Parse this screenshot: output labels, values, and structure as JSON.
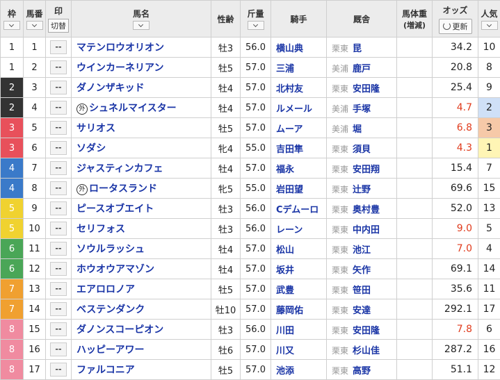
{
  "header": {
    "waku": "枠",
    "umaban": "馬番",
    "mark": "印",
    "mark_toggle": "切替",
    "name": "馬名",
    "sexage": "性齢",
    "kinryo": "斤量",
    "jockey": "騎手",
    "trainer": "厩舎",
    "weight": "馬体重",
    "weight_sub": "(増減)",
    "odds": "オッズ",
    "refresh": "更新",
    "ninki": "人気"
  },
  "waku_colors": {
    "1": {
      "bg": "#ffffff",
      "fg": "#222222"
    },
    "2": {
      "bg": "#333333",
      "fg": "#ffffff"
    },
    "3": {
      "bg": "#e8505b",
      "fg": "#ffffff"
    },
    "4": {
      "bg": "#3a7ac9",
      "fg": "#ffffff"
    },
    "5": {
      "bg": "#f0d230",
      "fg": "#ffffff"
    },
    "6": {
      "bg": "#4aa657",
      "fg": "#ffffff"
    },
    "7": {
      "bg": "#f0a030",
      "fg": "#ffffff"
    },
    "8": {
      "bg": "#f08ba0",
      "fg": "#ffffff"
    }
  },
  "mark_default": "--",
  "gaikoku_symbol": "外",
  "rows": [
    {
      "waku": "1",
      "umaban": "1",
      "name": "マテンロウオリオン",
      "gai": false,
      "sexage": "牡3",
      "kinryo": "56.0",
      "jockey": "横山典",
      "region": "栗東",
      "trainer": "昆",
      "weight": "",
      "odds": "34.2",
      "hot": false,
      "ninki": "10"
    },
    {
      "waku": "1",
      "umaban": "2",
      "name": "ウインカーネリアン",
      "gai": false,
      "sexage": "牡5",
      "kinryo": "57.0",
      "jockey": "三浦",
      "region": "美浦",
      "trainer": "鹿戸",
      "weight": "",
      "odds": "20.8",
      "hot": false,
      "ninki": "8"
    },
    {
      "waku": "2",
      "umaban": "3",
      "name": "ダノンザキッド",
      "gai": false,
      "sexage": "牡4",
      "kinryo": "57.0",
      "jockey": "北村友",
      "region": "栗東",
      "trainer": "安田隆",
      "weight": "",
      "odds": "25.4",
      "hot": false,
      "ninki": "9"
    },
    {
      "waku": "2",
      "umaban": "4",
      "name": "シュネルマイスター",
      "gai": true,
      "sexage": "牡4",
      "kinryo": "57.0",
      "jockey": "ルメール",
      "region": "美浦",
      "trainer": "手塚",
      "weight": "",
      "odds": "4.7",
      "hot": true,
      "ninki": "2"
    },
    {
      "waku": "3",
      "umaban": "5",
      "name": "サリオス",
      "gai": false,
      "sexage": "牡5",
      "kinryo": "57.0",
      "jockey": "ムーア",
      "region": "美浦",
      "trainer": "堀",
      "weight": "",
      "odds": "6.8",
      "hot": true,
      "ninki": "3"
    },
    {
      "waku": "3",
      "umaban": "6",
      "name": "ソダシ",
      "gai": false,
      "sexage": "牝4",
      "kinryo": "55.0",
      "jockey": "吉田隼",
      "region": "栗東",
      "trainer": "須貝",
      "weight": "",
      "odds": "4.3",
      "hot": true,
      "ninki": "1"
    },
    {
      "waku": "4",
      "umaban": "7",
      "name": "ジャスティンカフェ",
      "gai": false,
      "sexage": "牡4",
      "kinryo": "57.0",
      "jockey": "福永",
      "region": "栗東",
      "trainer": "安田翔",
      "weight": "",
      "odds": "15.4",
      "hot": false,
      "ninki": "7"
    },
    {
      "waku": "4",
      "umaban": "8",
      "name": "ロータスランド",
      "gai": true,
      "sexage": "牝5",
      "kinryo": "55.0",
      "jockey": "岩田望",
      "region": "栗東",
      "trainer": "辻野",
      "weight": "",
      "odds": "69.6",
      "hot": false,
      "ninki": "15"
    },
    {
      "waku": "5",
      "umaban": "9",
      "name": "ピースオブエイト",
      "gai": false,
      "sexage": "牡3",
      "kinryo": "56.0",
      "jockey": "Cデムーロ",
      "region": "栗東",
      "trainer": "奥村豊",
      "weight": "",
      "odds": "52.0",
      "hot": false,
      "ninki": "13"
    },
    {
      "waku": "5",
      "umaban": "10",
      "name": "セリフォス",
      "gai": false,
      "sexage": "牡3",
      "kinryo": "56.0",
      "jockey": "レーン",
      "region": "栗東",
      "trainer": "中内田",
      "weight": "",
      "odds": "9.0",
      "hot": true,
      "ninki": "5"
    },
    {
      "waku": "6",
      "umaban": "11",
      "name": "ソウルラッシュ",
      "gai": false,
      "sexage": "牡4",
      "kinryo": "57.0",
      "jockey": "松山",
      "region": "栗東",
      "trainer": "池江",
      "weight": "",
      "odds": "7.0",
      "hot": true,
      "ninki": "4"
    },
    {
      "waku": "6",
      "umaban": "12",
      "name": "ホウオウアマゾン",
      "gai": false,
      "sexage": "牡4",
      "kinryo": "57.0",
      "jockey": "坂井",
      "region": "栗東",
      "trainer": "矢作",
      "weight": "",
      "odds": "69.1",
      "hot": false,
      "ninki": "14"
    },
    {
      "waku": "7",
      "umaban": "13",
      "name": "エアロロノア",
      "gai": false,
      "sexage": "牡5",
      "kinryo": "57.0",
      "jockey": "武豊",
      "region": "栗東",
      "trainer": "笹田",
      "weight": "",
      "odds": "35.6",
      "hot": false,
      "ninki": "11"
    },
    {
      "waku": "7",
      "umaban": "14",
      "name": "ベステンダンク",
      "gai": false,
      "sexage": "牡10",
      "kinryo": "57.0",
      "jockey": "藤岡佑",
      "region": "栗東",
      "trainer": "安達",
      "weight": "",
      "odds": "292.1",
      "hot": false,
      "ninki": "17"
    },
    {
      "waku": "8",
      "umaban": "15",
      "name": "ダノンスコーピオン",
      "gai": false,
      "sexage": "牡3",
      "kinryo": "56.0",
      "jockey": "川田",
      "region": "栗東",
      "trainer": "安田隆",
      "weight": "",
      "odds": "7.8",
      "hot": true,
      "ninki": "6"
    },
    {
      "waku": "8",
      "umaban": "16",
      "name": "ハッピーアワー",
      "gai": false,
      "sexage": "牡6",
      "kinryo": "57.0",
      "jockey": "川又",
      "region": "栗東",
      "trainer": "杉山佳",
      "weight": "",
      "odds": "287.2",
      "hot": false,
      "ninki": "16"
    },
    {
      "waku": "8",
      "umaban": "17",
      "name": "ファルコニア",
      "gai": false,
      "sexage": "牡5",
      "kinryo": "57.0",
      "jockey": "池添",
      "region": "栗東",
      "trainer": "高野",
      "weight": "",
      "odds": "51.1",
      "hot": false,
      "ninki": "12"
    }
  ]
}
